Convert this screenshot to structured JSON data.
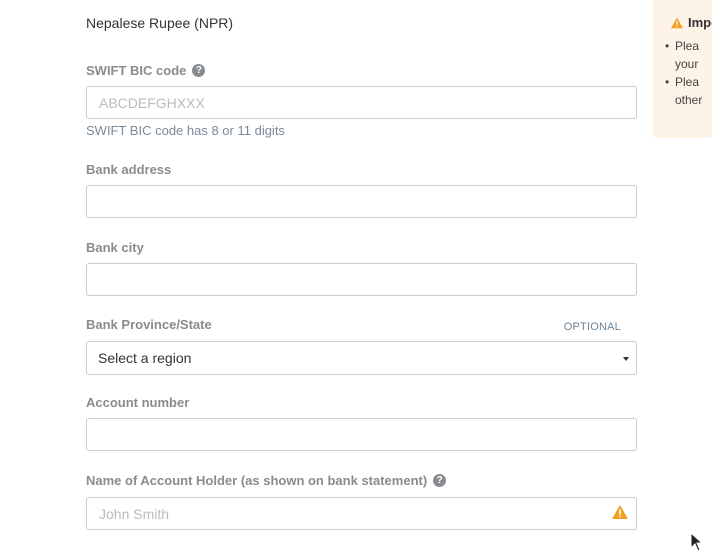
{
  "currency": {
    "name": "Nepalese Rupee (NPR)"
  },
  "fields": {
    "swift": {
      "label": "SWIFT BIC code",
      "placeholder": "ABCDEFGHXXX",
      "value": "",
      "hint": "SWIFT BIC code has 8 or 11 digits"
    },
    "bank_address": {
      "label": "Bank address",
      "value": ""
    },
    "bank_city": {
      "label": "Bank city",
      "value": ""
    },
    "bank_province": {
      "label": "Bank Province/State",
      "optional_text": "OPTIONAL",
      "selected": "Select a region"
    },
    "account_number": {
      "label": "Account number",
      "value": ""
    },
    "account_holder": {
      "label": "Name of Account Holder (as shown on bank statement)",
      "placeholder": "John Smith",
      "value": ""
    }
  },
  "notice": {
    "title": "Impo",
    "lines": [
      {
        "l1": "Plea",
        "l2": "your"
      },
      {
        "l1": "Plea",
        "l2": "other"
      }
    ]
  },
  "colors": {
    "label": "#888c90",
    "hint": "#7a8a99",
    "warning": "#f0a020",
    "notice_bg": "#fdf3e6"
  }
}
